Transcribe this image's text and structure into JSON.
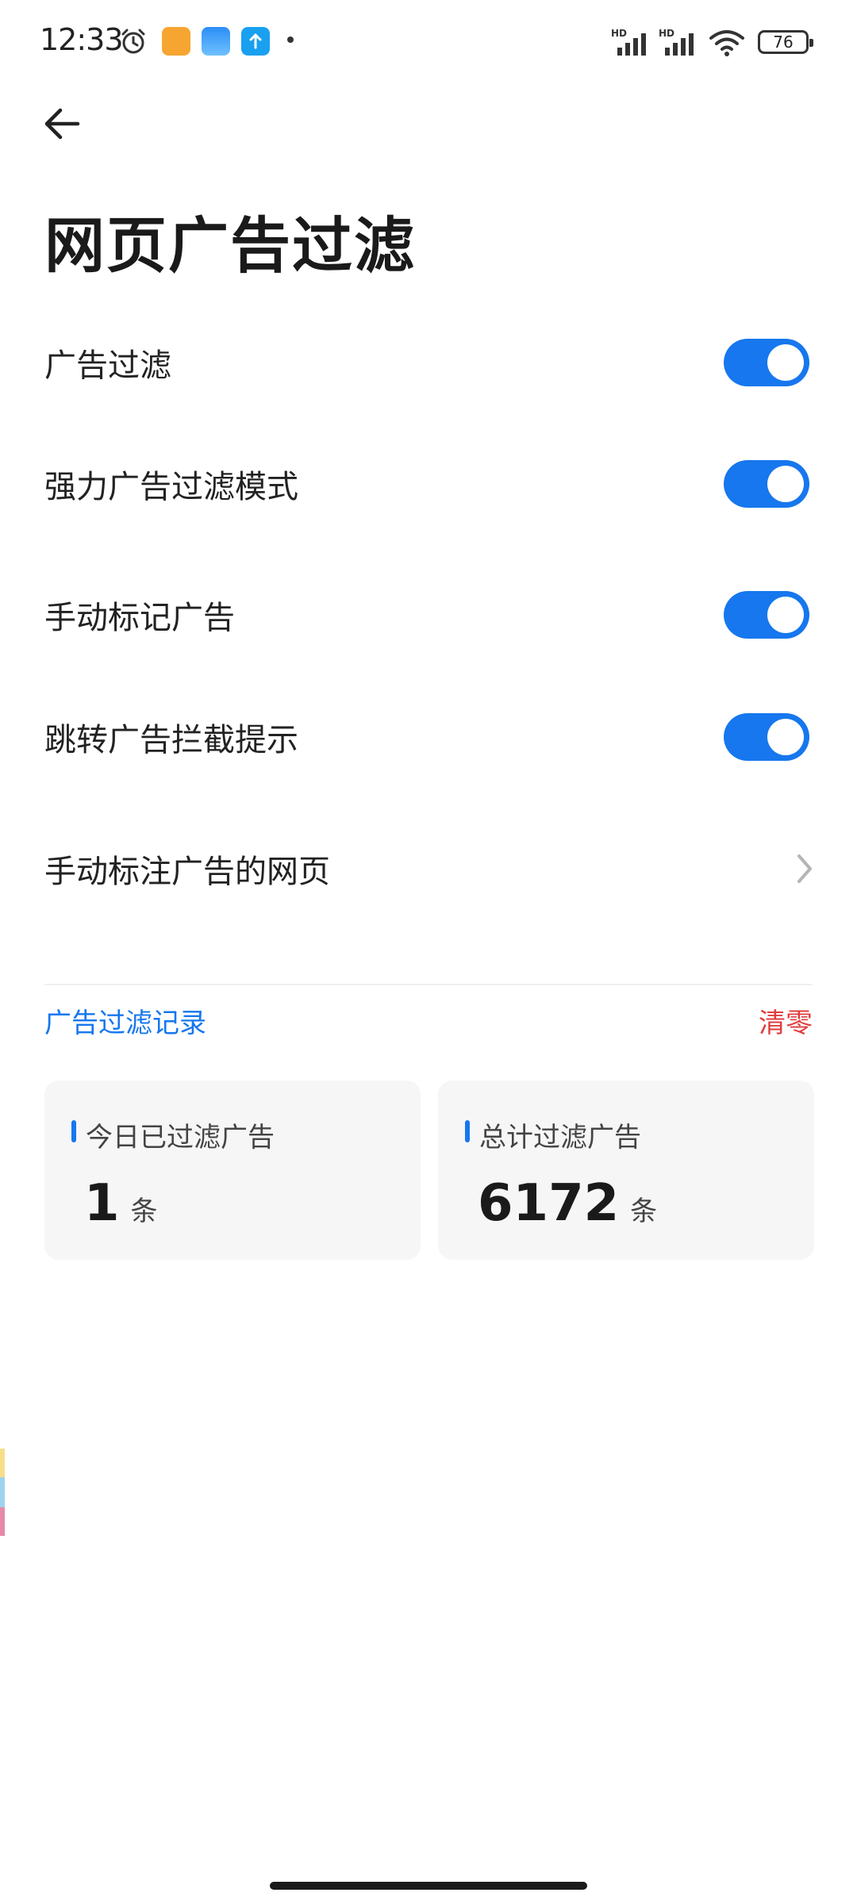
{
  "status_bar": {
    "time": "12:33",
    "battery": "76",
    "network_label": "HD"
  },
  "header": {
    "title": "网页广告过滤"
  },
  "settings": [
    {
      "label": "广告过滤",
      "type": "toggle",
      "on": true
    },
    {
      "label": "强力广告过滤模式",
      "type": "toggle",
      "on": true
    },
    {
      "label": "手动标记广告",
      "type": "toggle",
      "on": true
    },
    {
      "label": "跳转广告拦截提示",
      "type": "toggle",
      "on": true
    },
    {
      "label": "手动标注广告的网页",
      "type": "link"
    }
  ],
  "records": {
    "section_title": "广告过滤记录",
    "clear_label": "清零",
    "today": {
      "label": "今日已过滤广告",
      "value": "1",
      "unit": "条"
    },
    "total": {
      "label": "总计过滤广告",
      "value": "6172",
      "unit": "条"
    }
  },
  "colors": {
    "accent": "#1677ee",
    "danger": "#e03d3d",
    "card_bg": "#f6f6f6"
  }
}
